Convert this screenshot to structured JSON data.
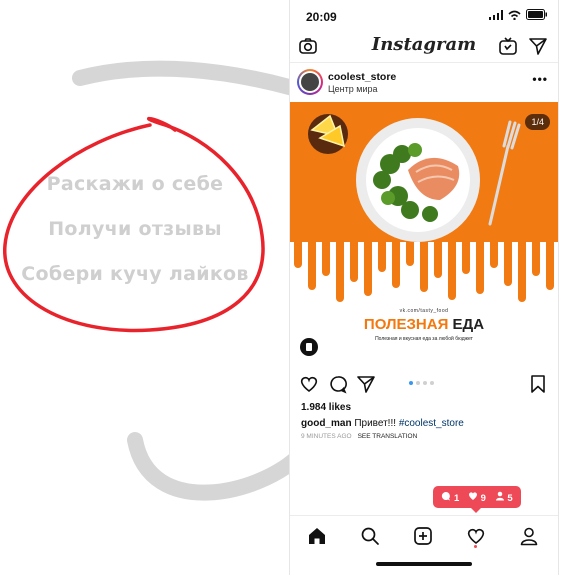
{
  "left_panel": {
    "taglines": [
      "Раскажи о себе",
      "Получи отзывы",
      "Собери кучу лайков"
    ]
  },
  "status_bar": {
    "time": "20:09"
  },
  "header": {
    "logo": "Instagram"
  },
  "post": {
    "username": "coolest_store",
    "location": "Центр мира",
    "more_label": "•••",
    "image": {
      "counter": "1/4",
      "url": "vk.com/tasty_food",
      "title_part1": "ПОЛЕЗНАЯ",
      "title_part2": "ЕДА",
      "subtitle": "Полезная и вкусная еда за любой бюджет"
    },
    "carousel": {
      "count": 4,
      "active": 1
    },
    "likes": "1.984 likes",
    "caption": {
      "user": "good_man",
      "text": " Привет!!! ",
      "hashtag": "#coolest_store"
    },
    "time_ago": "9 MINUTES AGO",
    "see_translation": "SEE TRANSLATION"
  },
  "notification": {
    "comments": "1",
    "likes": "9",
    "followers": "5"
  },
  "colors": {
    "accent_red": "#ed4956",
    "orange": "#f17a12",
    "link_blue": "#003569",
    "carousel_active": "#3897f0"
  },
  "icons": {
    "header": [
      "camera-icon",
      "igtv-icon",
      "direct-icon"
    ],
    "actions": [
      "heart-icon",
      "comment-icon",
      "share-icon",
      "bookmark-icon"
    ],
    "nav": [
      "home-icon",
      "search-icon",
      "add-icon",
      "activity-icon",
      "profile-icon"
    ]
  }
}
